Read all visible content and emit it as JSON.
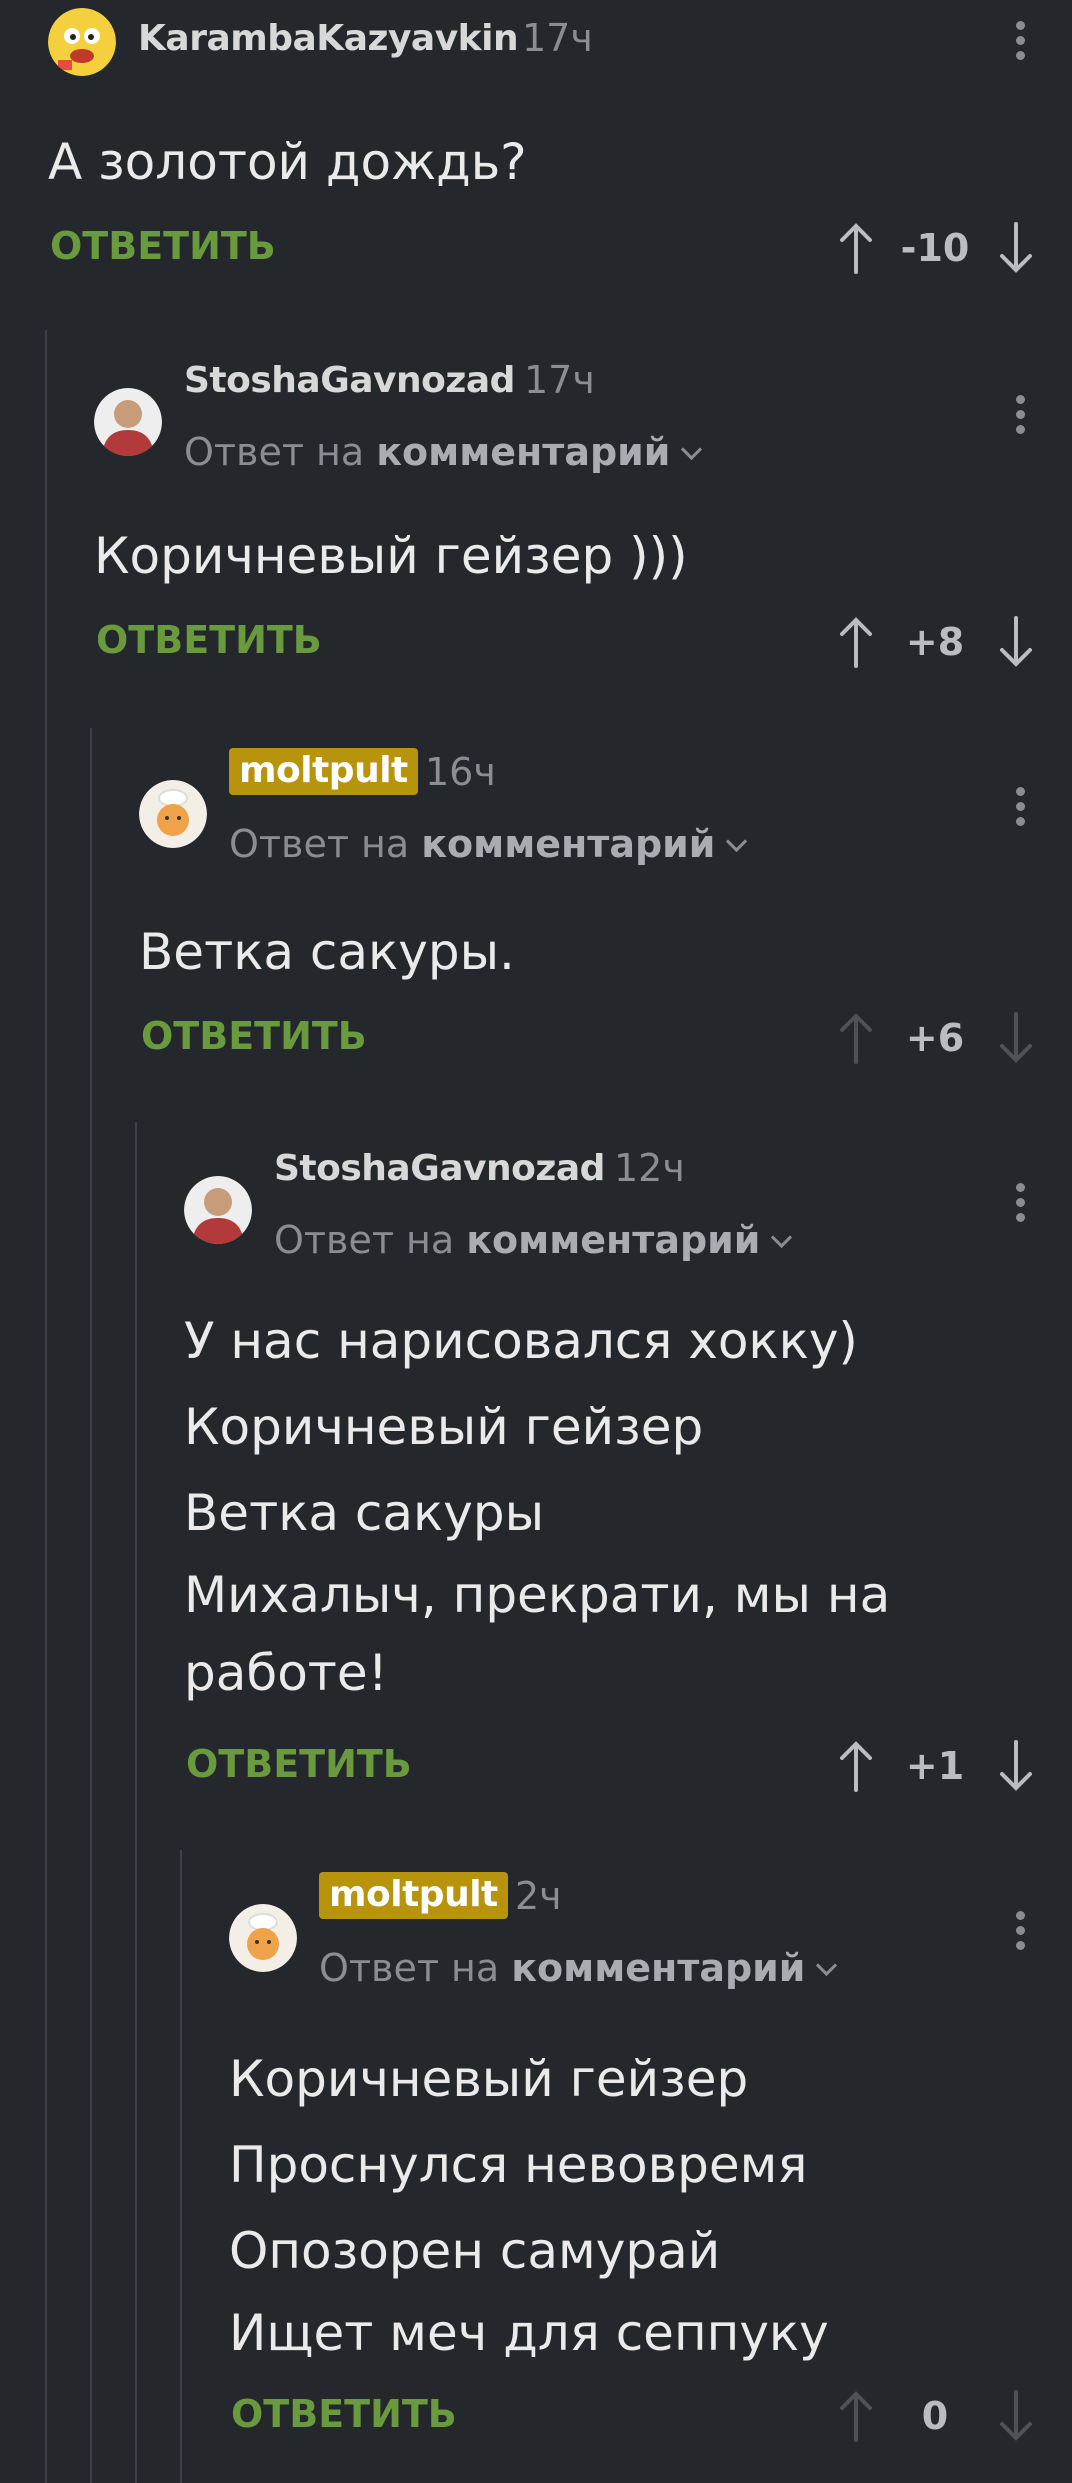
{
  "comments": [
    {
      "author": "KarambaKazyavkin",
      "time": "17ч",
      "reply_prefix": "",
      "reply_link": "",
      "lines": [
        "А золотой дождь?"
      ],
      "reply_label": "ОТВЕТИТЬ",
      "score": "-10",
      "arrows_dim": false,
      "tagged": false
    },
    {
      "author": "StoshaGavnozad",
      "time": "17ч",
      "reply_prefix": "Ответ на",
      "reply_link": "комментарий",
      "lines": [
        "Коричневый гейзер )))"
      ],
      "reply_label": "ОТВЕТИТЬ",
      "score": "+8",
      "arrows_dim": false,
      "tagged": false
    },
    {
      "author": "moltpult",
      "time": "16ч",
      "reply_prefix": "Ответ на",
      "reply_link": "комментарий",
      "lines": [
        "Ветка сакуры."
      ],
      "reply_label": "ОТВЕТИТЬ",
      "score": "+6",
      "arrows_dim": true,
      "tagged": true
    },
    {
      "author": "StoshaGavnozad",
      "time": "12ч",
      "reply_prefix": "Ответ на",
      "reply_link": "комментарий",
      "lines": [
        "У нас нарисовался хокку)",
        "Коричневый гейзер",
        "Ветка сакуры",
        "Михалыч, прекрати, мы на",
        "работе!"
      ],
      "reply_label": "ОТВЕТИТЬ",
      "score": "+1",
      "arrows_dim": false,
      "tagged": false
    },
    {
      "author": "moltpult",
      "time": "2ч",
      "reply_prefix": "Ответ на",
      "reply_link": "комментарий",
      "lines": [
        "Коричневый гейзер",
        "Проснулся невовремя",
        "Опозорен самурай",
        "Ищет меч для сеппуку"
      ],
      "reply_label": "ОТВЕТИТЬ",
      "score": "0",
      "arrows_dim": true,
      "tagged": true
    }
  ],
  "colors": {
    "background": "#24272b",
    "reply_green": "#6a9a3e",
    "tag_gold": "#b8930c",
    "thread_line": "#3d4147"
  },
  "icons": {
    "upvote": "arrow-up-icon",
    "downvote": "arrow-down-icon",
    "menu": "more-vertical-icon",
    "expand": "chevron-down-icon"
  }
}
